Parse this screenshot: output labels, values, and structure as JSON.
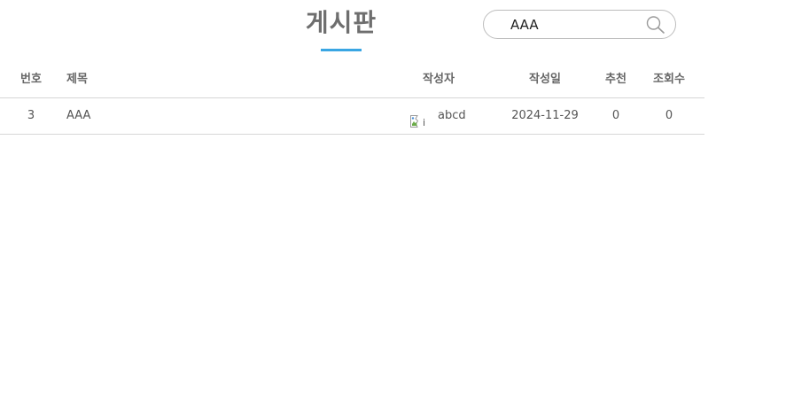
{
  "page": {
    "title": "게시판",
    "accent_color": "#3aa6e3"
  },
  "search": {
    "value": "AAA",
    "icon": "search-icon"
  },
  "table": {
    "columns": {
      "no": "번호",
      "title": "제목",
      "author": "작성자",
      "date": "작성일",
      "recommend": "추천",
      "views": "조회수"
    },
    "rows": [
      {
        "no": "3",
        "title": "AAA",
        "author_image_alt": "i",
        "author": "abcd",
        "date": "2024-11-29",
        "recommend": "0",
        "views": "0"
      }
    ]
  }
}
